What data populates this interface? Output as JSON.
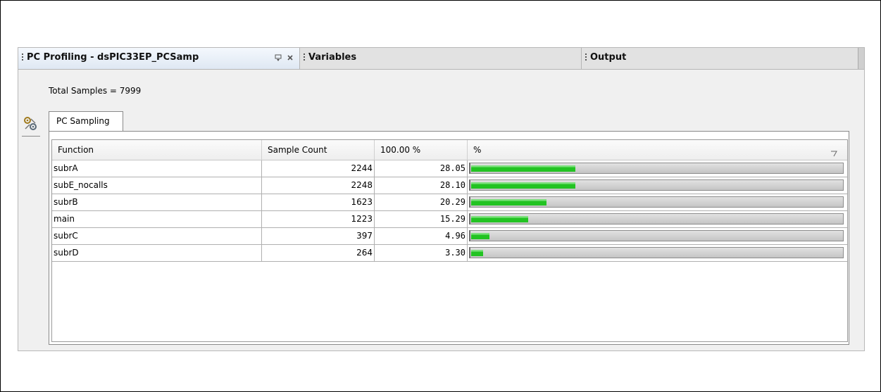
{
  "window": {
    "tabs": [
      {
        "label": "PC Profiling - dsPIC33EP_PCSamp",
        "active": true
      },
      {
        "label": "Variables",
        "active": false
      },
      {
        "label": "Output",
        "active": false
      }
    ]
  },
  "summary": {
    "total_samples": "Total Samples = 7999"
  },
  "subtab": {
    "label": "PC Sampling"
  },
  "table": {
    "headers": {
      "function": "Function",
      "count": "Sample Count",
      "pct": "100.00 %",
      "bar": "%"
    },
    "rows": [
      {
        "function": "subrA",
        "count": "2244",
        "pct": "28.05",
        "fraction": 0.2805
      },
      {
        "function": "subE_nocalls",
        "count": "2248",
        "pct": "28.10",
        "fraction": 0.281
      },
      {
        "function": "subrB",
        "count": "1623",
        "pct": "20.29",
        "fraction": 0.2029
      },
      {
        "function": "main",
        "count": "1223",
        "pct": "15.29",
        "fraction": 0.1529
      },
      {
        "function": "subrC",
        "count": "397",
        "pct": "4.96",
        "fraction": 0.0496
      },
      {
        "function": "subrD",
        "count": "264",
        "pct": "3.30",
        "fraction": 0.033
      }
    ]
  },
  "icons": {
    "tool": "tools-icon",
    "minimize": "minimize-icon",
    "close": "close-icon",
    "sort": "sort-indicator-icon"
  },
  "colors": {
    "bar_green": "#22c322",
    "tab_active": "#dfe8f3"
  }
}
